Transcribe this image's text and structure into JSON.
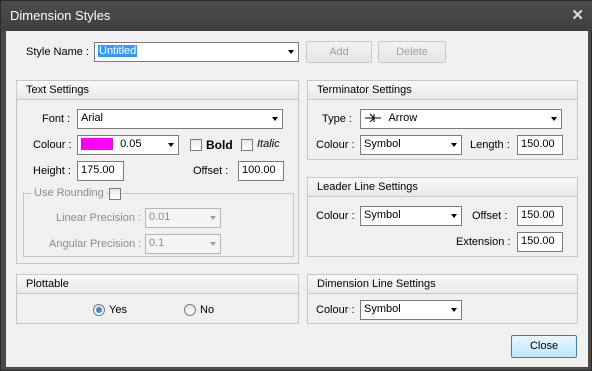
{
  "window": {
    "title": "Dimension Styles"
  },
  "style_name": {
    "label": "Style Name :",
    "value": "Untitled",
    "add_label": "Add",
    "delete_label": "Delete"
  },
  "text_settings": {
    "header": "Text Settings",
    "font_label": "Font :",
    "font_value": "Arial",
    "colour_label": "Colour :",
    "colour_value": "0.05",
    "colour_swatch": "#ff00ff",
    "bold_label": "Bold",
    "italic_label": "Italic",
    "height_label": "Height :",
    "height_value": "175.00",
    "offset_label": "Offset :",
    "offset_value": "100.00",
    "use_rounding_label": "Use Rounding",
    "linear_precision_label": "Linear Precision :",
    "linear_precision_value": "0.01",
    "angular_precision_label": "Angular Precision :",
    "angular_precision_value": "0.1"
  },
  "plottable": {
    "header": "Plottable",
    "yes_label": "Yes",
    "no_label": "No",
    "selected": "Yes"
  },
  "terminator_settings": {
    "header": "Terminator Settings",
    "type_label": "Type :",
    "type_value": "Arrow",
    "colour_label": "Colour :",
    "colour_value": "Symbol",
    "length_label": "Length :",
    "length_value": "150.00"
  },
  "leader_line_settings": {
    "header": "Leader Line Settings",
    "colour_label": "Colour :",
    "colour_value": "Symbol",
    "offset_label": "Offset :",
    "offset_value": "150.00",
    "extension_label": "Extension :",
    "extension_value": "150.00"
  },
  "dimension_line_settings": {
    "header": "Dimension Line Settings",
    "colour_label": "Colour :",
    "colour_value": "Symbol"
  },
  "footer": {
    "close_label": "Close"
  },
  "colors": {
    "accent": "#3399ff",
    "swatch": "#ff00ff",
    "titlebar": "#454545",
    "dialog": "#f0f0f0"
  }
}
